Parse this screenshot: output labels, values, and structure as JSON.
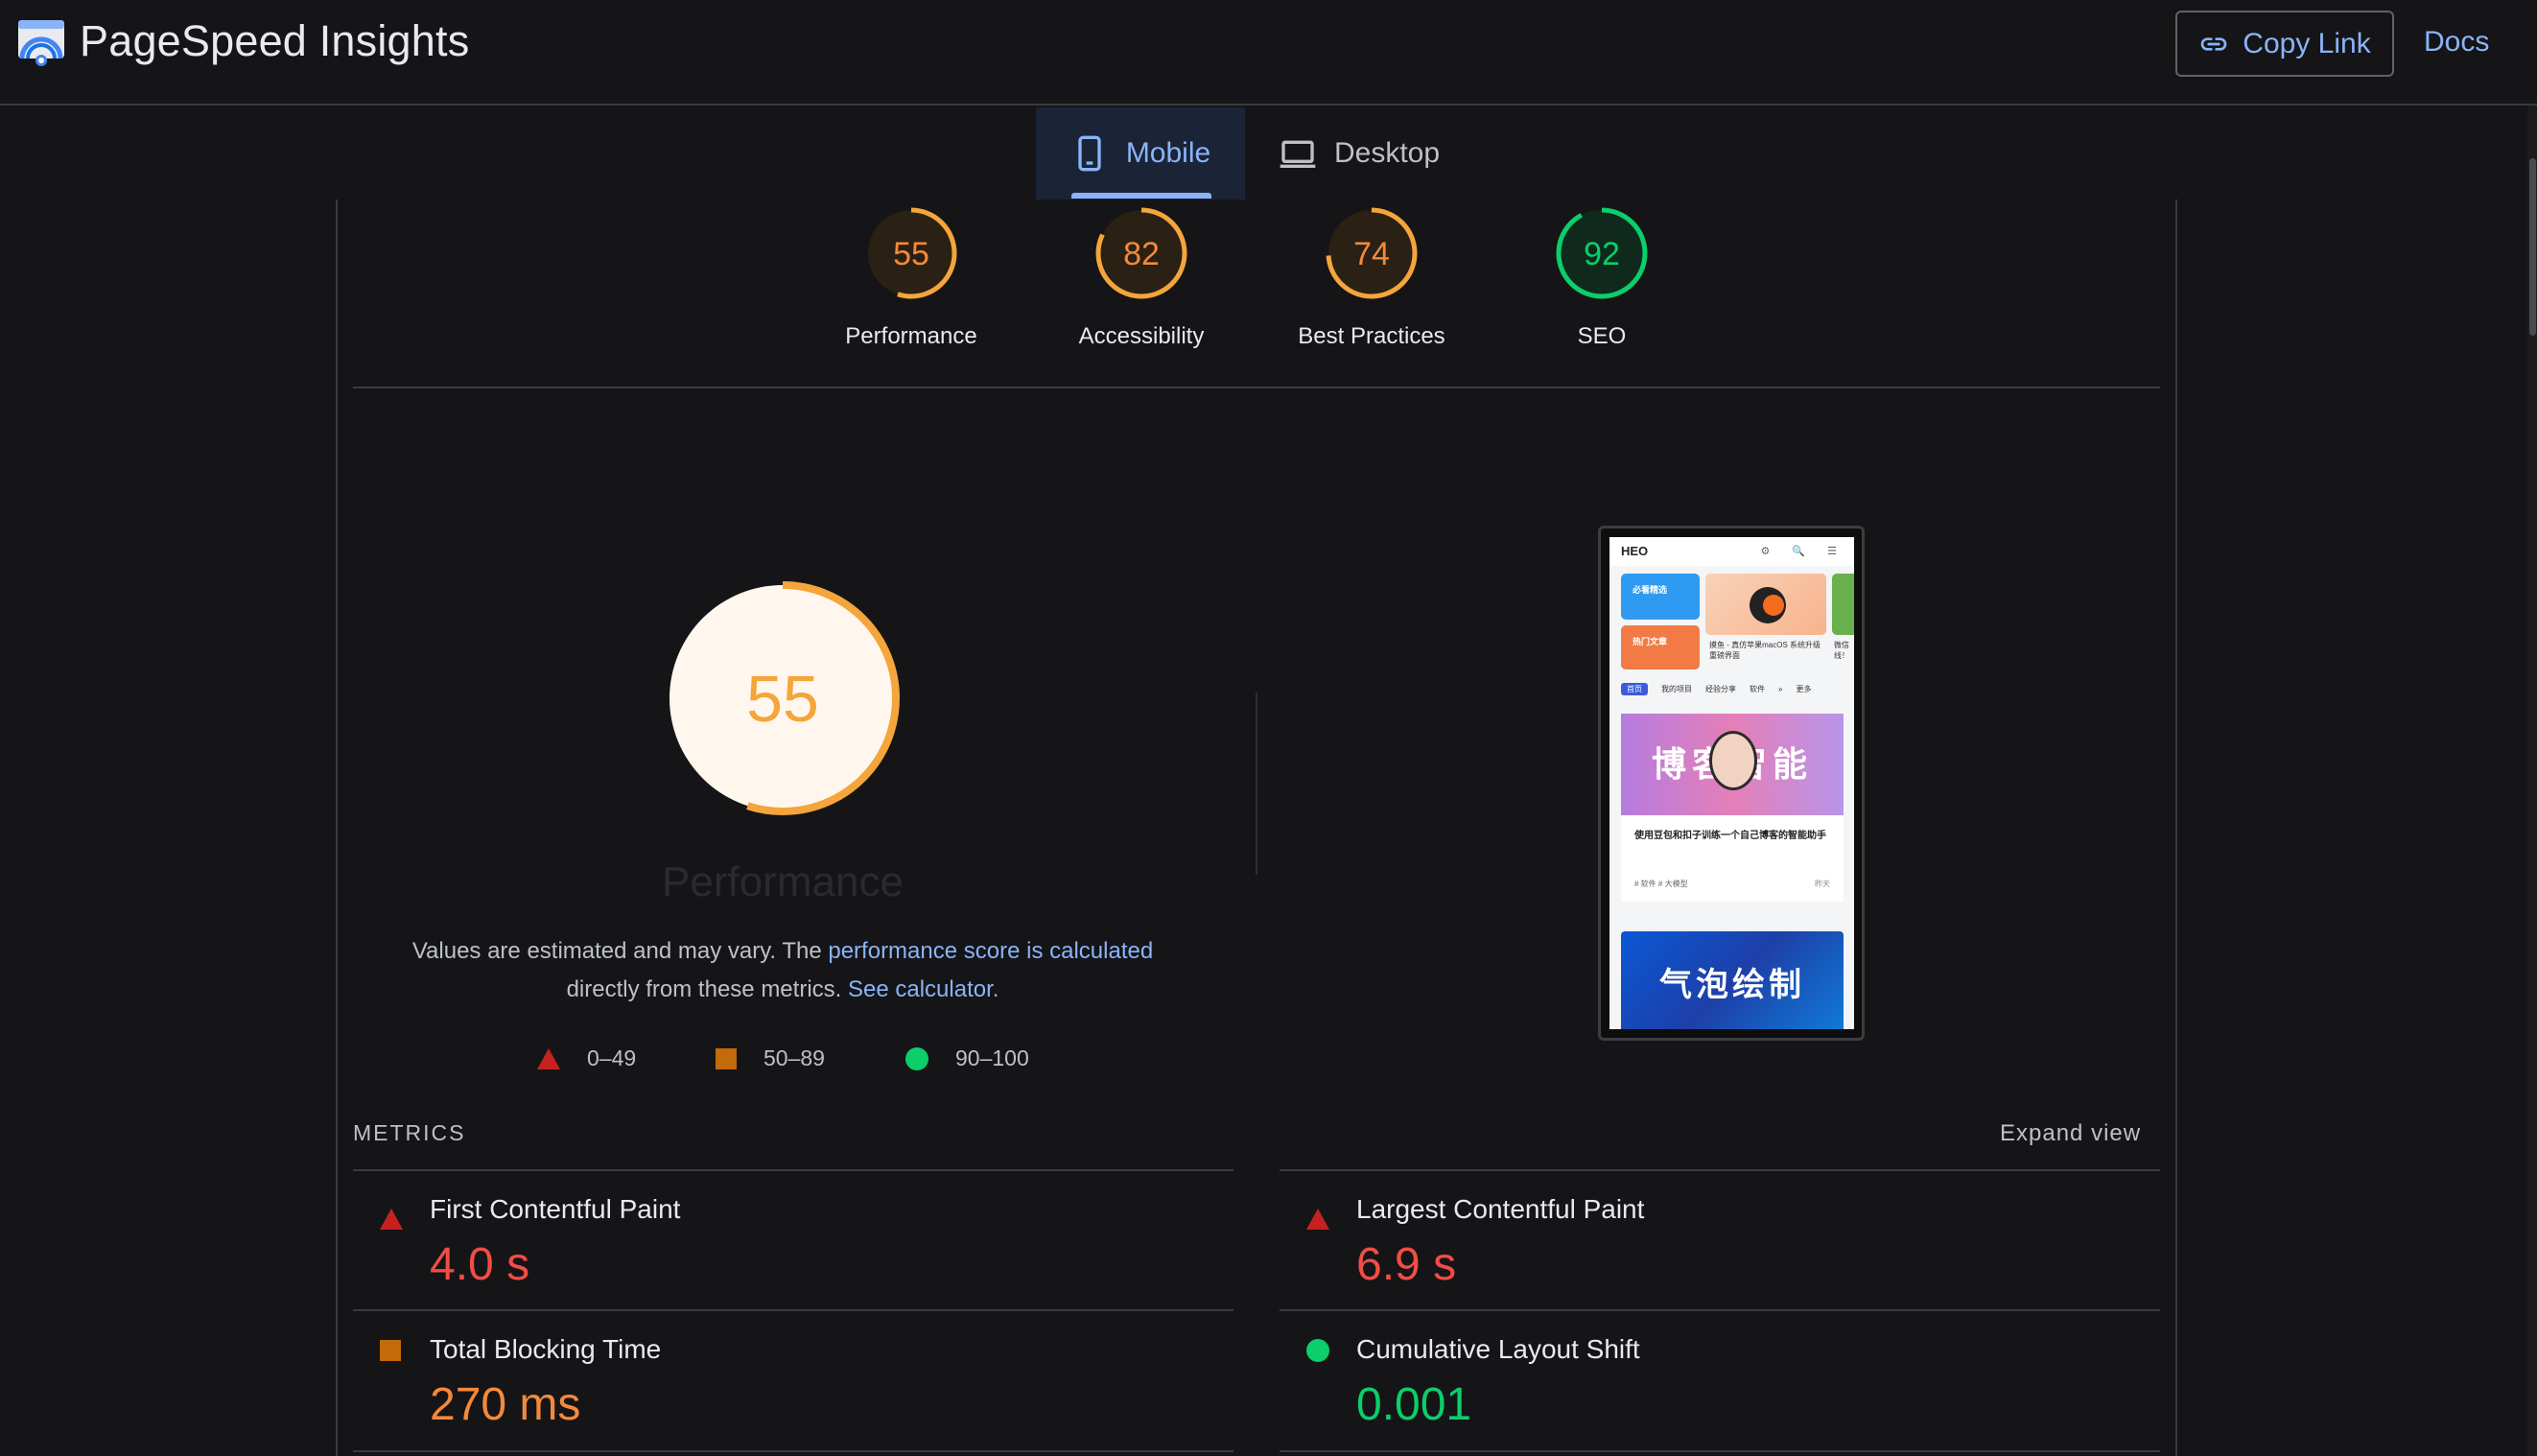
{
  "header": {
    "app_title": "PageSpeed Insights",
    "copy_link_label": "Copy Link",
    "docs_label": "Docs"
  },
  "tabs": [
    {
      "label": "Mobile",
      "active": true,
      "icon": "smartphone-icon"
    },
    {
      "label": "Desktop",
      "active": false,
      "icon": "laptop-icon"
    }
  ],
  "scores": [
    {
      "label": "Performance",
      "value": 55,
      "color": "#f4a53b"
    },
    {
      "label": "Accessibility",
      "value": 82,
      "color": "#f4a53b"
    },
    {
      "label": "Best Practices",
      "value": 74,
      "color": "#f4a53b"
    },
    {
      "label": "SEO",
      "value": 92,
      "color": "#0cce6b"
    }
  ],
  "performance": {
    "score": "55",
    "label": "Performance",
    "desc_part1": "Values are estimated and may vary. The ",
    "desc_link1": "performance score is calculated",
    "desc_part2": "directly from these metrics. ",
    "desc_link2": "See calculator."
  },
  "legend": [
    {
      "range": "0–49",
      "color": "#c5221f"
    },
    {
      "range": "50–89",
      "color": "#c36a0a"
    },
    {
      "range": "90–100",
      "color": "#0cce6b"
    }
  ],
  "screenshot": {
    "logo": "HEO",
    "icons": "⚙ 🔍 ☰",
    "tile1": "必看精选",
    "tile2": "热门文章",
    "card_caption": "摸鱼 - 真仿苹果macOS 系统升级重磅界面",
    "side_caption": "微信 线！",
    "nav": [
      "首页",
      "我的项目",
      "经验分享",
      "软件",
      "»",
      "更多"
    ],
    "banner1": "博客智能",
    "post_title": "使用豆包和扣子训练一个自己博客的智能助手",
    "post_tags": "# 软件  # 大模型",
    "post_time": "昨天",
    "banner2": "气泡绘制"
  },
  "metrics_section": {
    "title": "METRICS",
    "expand_label": "Expand view",
    "items": [
      {
        "name": "First Contentful Paint",
        "value": "4.0 s",
        "status": "poor"
      },
      {
        "name": "Largest Contentful Paint",
        "value": "6.9 s",
        "status": "poor"
      },
      {
        "name": "Total Blocking Time",
        "value": "270 ms",
        "status": "average"
      },
      {
        "name": "Cumulative Layout Shift",
        "value": "0.001",
        "status": "good"
      }
    ]
  },
  "colors": {
    "background": "#151517",
    "accent": "#8ab4f8",
    "poor": "#f24d45",
    "average": "#f4893b",
    "good": "#0cce6b"
  }
}
